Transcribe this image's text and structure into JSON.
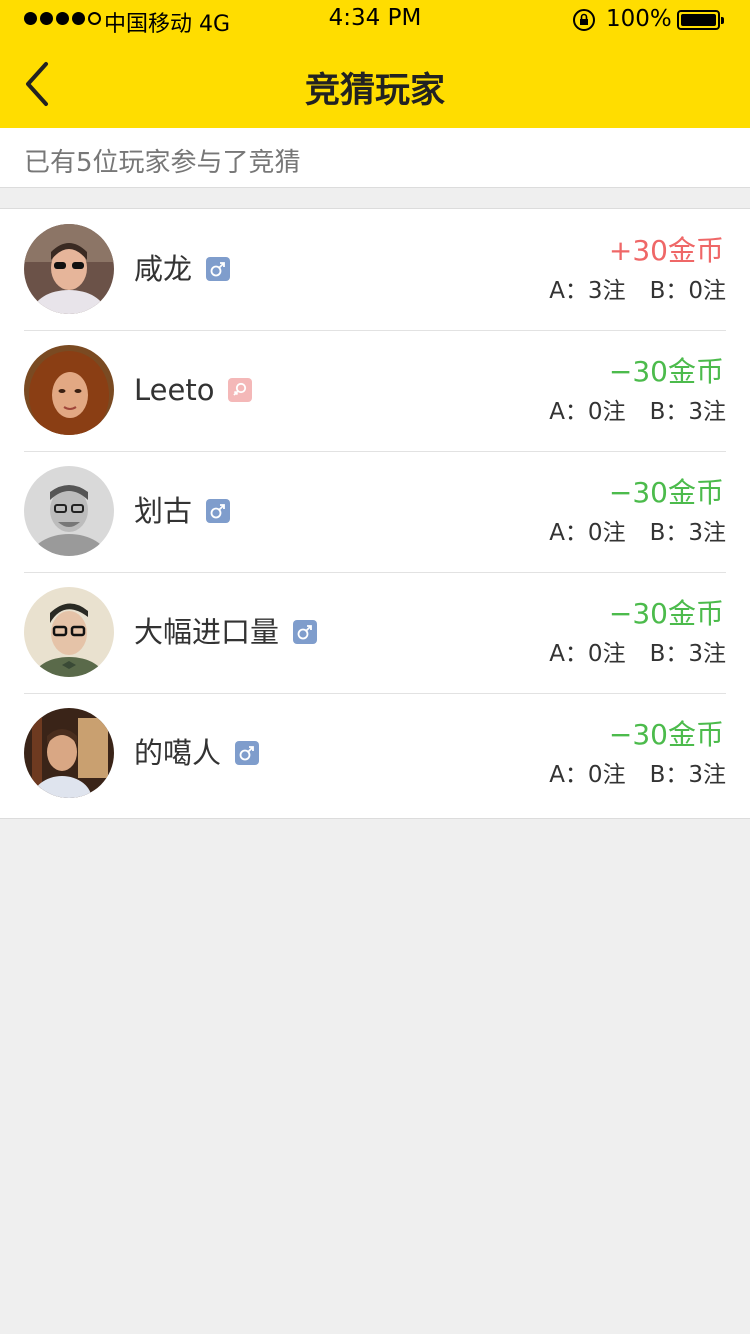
{
  "status_bar": {
    "carrier": "中国移动  4G",
    "time": "4:34 PM",
    "battery": "100%"
  },
  "nav": {
    "title": "竞猜玩家",
    "back_icon": "chevron-left-icon"
  },
  "summary": {
    "text": "已有5位玩家参与了竞猜"
  },
  "players": [
    {
      "name": "咸龙",
      "gender": "male",
      "amount": "+30金币",
      "result": "win",
      "bet_a": "A：3注",
      "bet_b": "B：0注"
    },
    {
      "name": "Leeto",
      "gender": "female",
      "amount": "−30金币",
      "result": "lose",
      "bet_a": "A：0注",
      "bet_b": "B：3注"
    },
    {
      "name": "划古",
      "gender": "male",
      "amount": "−30金币",
      "result": "lose",
      "bet_a": "A：0注",
      "bet_b": "B：3注"
    },
    {
      "name": "大幅进口量",
      "gender": "male",
      "amount": "−30金币",
      "result": "lose",
      "bet_a": "A：0注",
      "bet_b": "B：3注"
    },
    {
      "name": "的噶人",
      "gender": "male",
      "amount": "−30金币",
      "result": "lose",
      "bet_a": "A：0注",
      "bet_b": "B：3注"
    }
  ],
  "colors": {
    "header": "#ffdd00",
    "win": "#ef6767",
    "lose": "#4cbb4c",
    "male_badge": "#7f9dcc",
    "female_badge": "#f4b8b8"
  }
}
